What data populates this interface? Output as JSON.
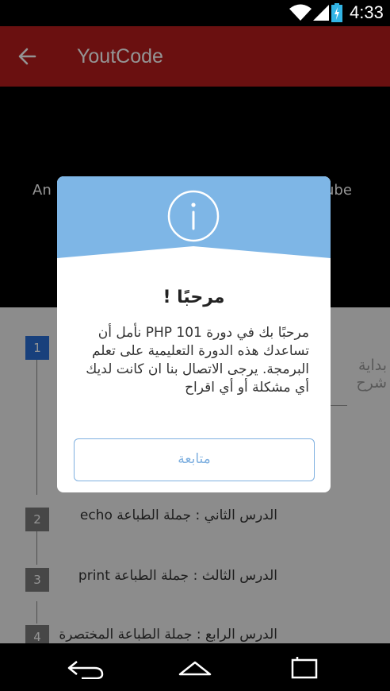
{
  "status_bar": {
    "time": "4:33",
    "icons": [
      "wifi-icon",
      "signal-icon",
      "battery-charging-icon"
    ]
  },
  "app_bar": {
    "title": "YoutCode",
    "back_icon": "arrow-back-icon",
    "color": "#b71c1c"
  },
  "header": {
    "text_left": "An",
    "text_right": "ube"
  },
  "lessons": [
    {
      "number": "1",
      "title": "",
      "active": true
    },
    {
      "number": "2",
      "title": "الدرس الثاني : جملة الطباعة echo"
    },
    {
      "number": "3",
      "title": "الدرس الثالث : جملة الطباعة print"
    },
    {
      "number": "4",
      "title": "الدرس الرابع : جملة الطباعة المختصرة"
    }
  ],
  "side_texts": [
    "بداية",
    "شرح"
  ],
  "dialog": {
    "icon": "info-icon",
    "header_color": "#7eb6e6",
    "title": "مرحبًا !",
    "message": "مرحبًا بك في دورة PHP 101 نأمل أن تساعدك هذه الدورة التعليمية على تعلم البرمجة. يرجى الاتصال بنا ان كانت لديك أي مشكلة أو أي اقراح",
    "button_label": "متابعة"
  },
  "nav_bar": {
    "icons": [
      "back-nav-icon",
      "home-nav-icon",
      "recents-nav-icon"
    ]
  }
}
